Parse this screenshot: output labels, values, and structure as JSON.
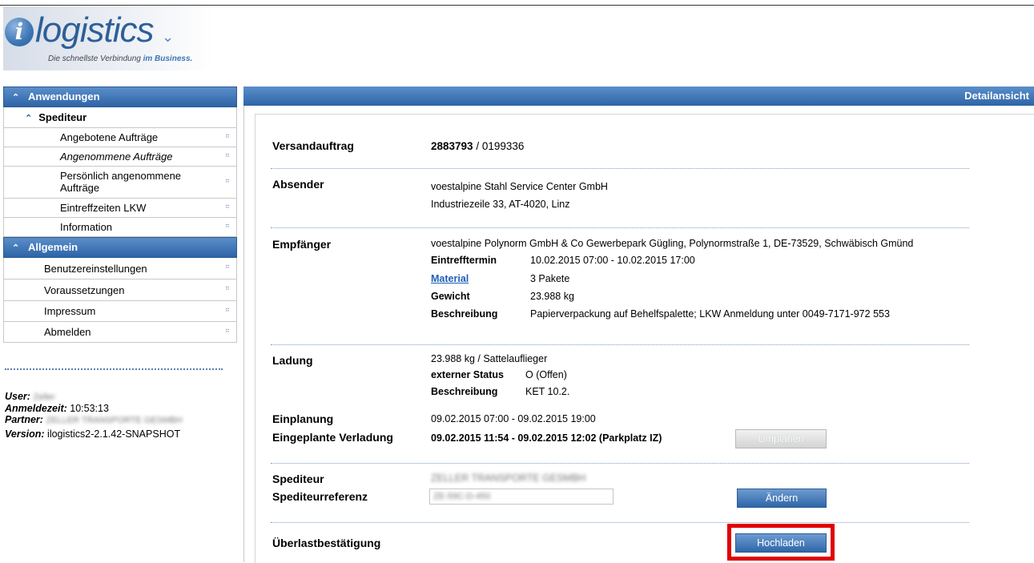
{
  "logo": {
    "letter": "i",
    "word": "logistics",
    "tagline_part1": "Die schnellste Verbindung",
    "tagline_part2": "im Business."
  },
  "sidebar": {
    "section1": {
      "title": "Anwendungen"
    },
    "sub1": {
      "title": "Spediteur"
    },
    "items1": [
      "Angebotene Aufträge",
      "Angenommene Aufträge",
      "Persönlich angenommene Aufträge",
      "Eintreffzeiten LKW",
      "Information"
    ],
    "section2": {
      "title": "Allgemein"
    },
    "items2": [
      "Benutzereinstellungen",
      "Voraussetzungen",
      "Impressum",
      "Abmelden"
    ]
  },
  "userinfo": {
    "user_label": "User:",
    "user_value": "Zeller",
    "login_label": "Anmeldezeit:",
    "login_value": "10:53:13",
    "partner_label": "Partner:",
    "partner_value": "ZELLER TRANSPORTE GESMBH",
    "version_label": "Version:",
    "version_value": "ilogistics2-2.1.42-SNAPSHOT"
  },
  "main": {
    "header": "Detailansicht",
    "versand_label": "Versandauftrag",
    "versand_number": "2883793",
    "versand_suffix": "/ 0199336",
    "absender_label": "Absender",
    "absender_line1": "voestalpine Stahl Service Center GmbH",
    "absender_line2": "Industriezeile 33, AT-4020, Linz",
    "empf_label": "Empfänger",
    "empf_line": "voestalpine Polynorm GmbH & Co Gewerbepark Gügling, Polynormstraße 1, DE-73529, Schwäbisch Gmünd",
    "eintreff_label": "Eintrefftermin",
    "eintreff_value": "10.02.2015 07:00 - 10.02.2015 17:00",
    "material_label": "Material",
    "material_value": "3 Pakete",
    "gewicht_label": "Gewicht",
    "gewicht_value": "23.988 kg",
    "beschr_label": "Beschreibung",
    "beschr_value": "Papierverpackung auf Behelfspalette; LKW Anmeldung unter 0049-7171-972 553",
    "ladung_label": "Ladung",
    "ladung_value": "23.988 kg / Sattelauflieger",
    "status_label": "externer Status",
    "status_value": "O (Offen)",
    "ladung_beschr_label": "Beschreibung",
    "ladung_beschr_value": "KET 10.2.",
    "einplanung_label": "Einplanung",
    "einplanung_value": "09.02.2015 07:00 - 09.02.2015 19:00",
    "verladung_label": "Eingeplante Verladung",
    "verladung_value": "09.02.2015 11:54 - 09.02.2015 12:02 (Parkplatz IZ)",
    "umplanen_button": "Umplanen",
    "spediteur_label": "Spediteur",
    "spediteur_value": "ZELLER TRANSPORTE GESMBH",
    "sped_ref_label": "Spediteurreferenz",
    "sped_ref_value": "ZE-59C-D-450",
    "aendern_button": "Ändern",
    "ueberlast_label": "Überlastbestätigung",
    "hochladen_button": "Hochladen"
  },
  "colors": {
    "header_blue": "#2d64a6",
    "highlight": "#e00000",
    "link": "#1f5fb8"
  }
}
